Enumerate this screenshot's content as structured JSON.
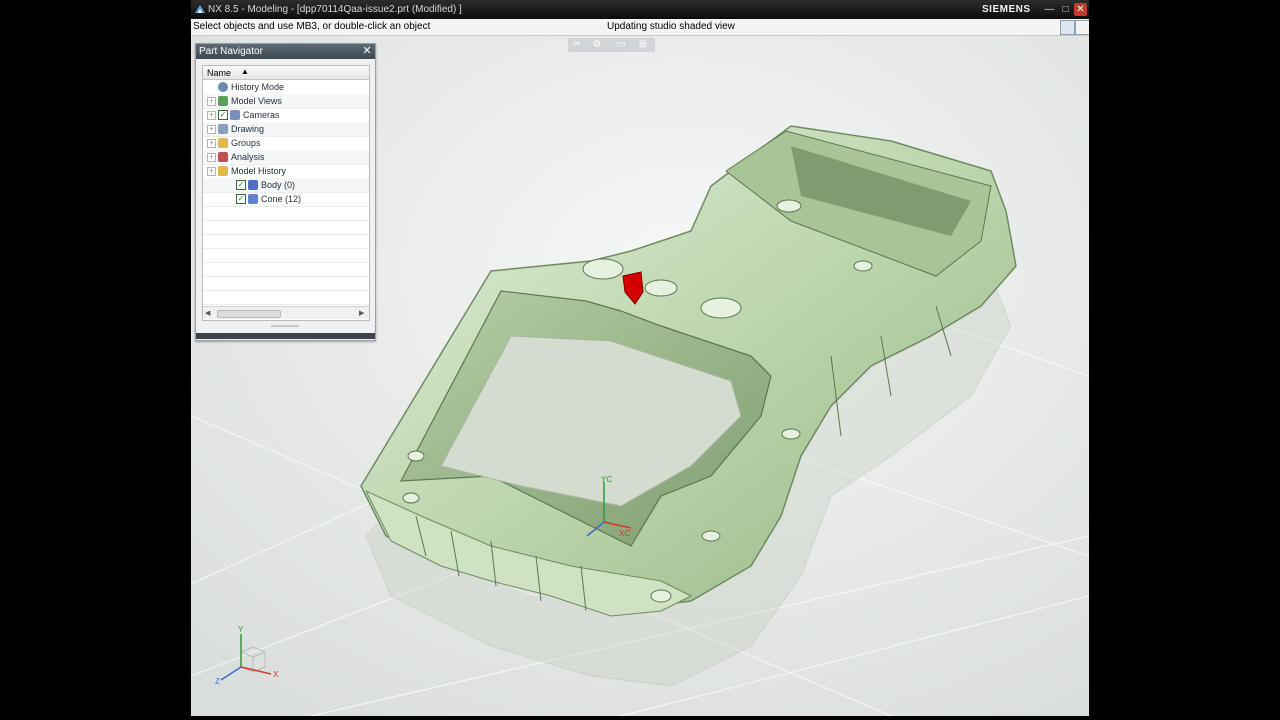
{
  "window": {
    "title": "NX 8.5 - Modeling - [dpp70114Qaa-issue2.prt (Modified) ]",
    "brand": "SIEMENS",
    "minimize": "—",
    "maximize": "□",
    "close": "✕"
  },
  "cue_line": {
    "prompt": "Select objects and use MB3, or double-click an object",
    "status": "Updating studio shaded view"
  },
  "mini_toolbar": [
    "✂",
    "⚙",
    "▭",
    "⊞"
  ],
  "part_navigator": {
    "title": "Part Navigator",
    "close": "✕",
    "column": "Name",
    "sort_arrow": "▲",
    "items": [
      {
        "label": "History Mode",
        "icon": "clock-icon",
        "expander": false,
        "checked": false,
        "indent": 0
      },
      {
        "label": "Model Views",
        "icon": "model-views-icon",
        "expander": true,
        "checked": false,
        "indent": 0
      },
      {
        "label": "Cameras",
        "icon": "camera-icon",
        "expander": true,
        "checked": true,
        "indent": 0
      },
      {
        "label": "Drawing",
        "icon": "drawing-icon",
        "expander": true,
        "checked": false,
        "indent": 0
      },
      {
        "label": "Groups",
        "icon": "folder-icon",
        "expander": true,
        "checked": false,
        "indent": 0
      },
      {
        "label": "Analysis",
        "icon": "analysis-icon",
        "expander": true,
        "checked": false,
        "indent": 0
      },
      {
        "label": "Model History",
        "icon": "folder-icon",
        "expander": true,
        "checked": false,
        "indent": 0
      },
      {
        "label": "Body (0)",
        "icon": "body-icon",
        "expander": false,
        "checked": true,
        "indent": 1
      },
      {
        "label": "Cone (12)",
        "icon": "cone-icon",
        "expander": false,
        "checked": true,
        "indent": 1
      }
    ],
    "scroll_left": "◀",
    "scroll_right": "▶"
  },
  "triad": {
    "x": "X",
    "y": "Y",
    "z": "Z"
  },
  "wcs": {
    "xc": "XC",
    "yc": "YC"
  },
  "colors": {
    "model": "#cfe3c3",
    "accent_red": "#d40000",
    "title_bar": "#1a1a1a"
  }
}
